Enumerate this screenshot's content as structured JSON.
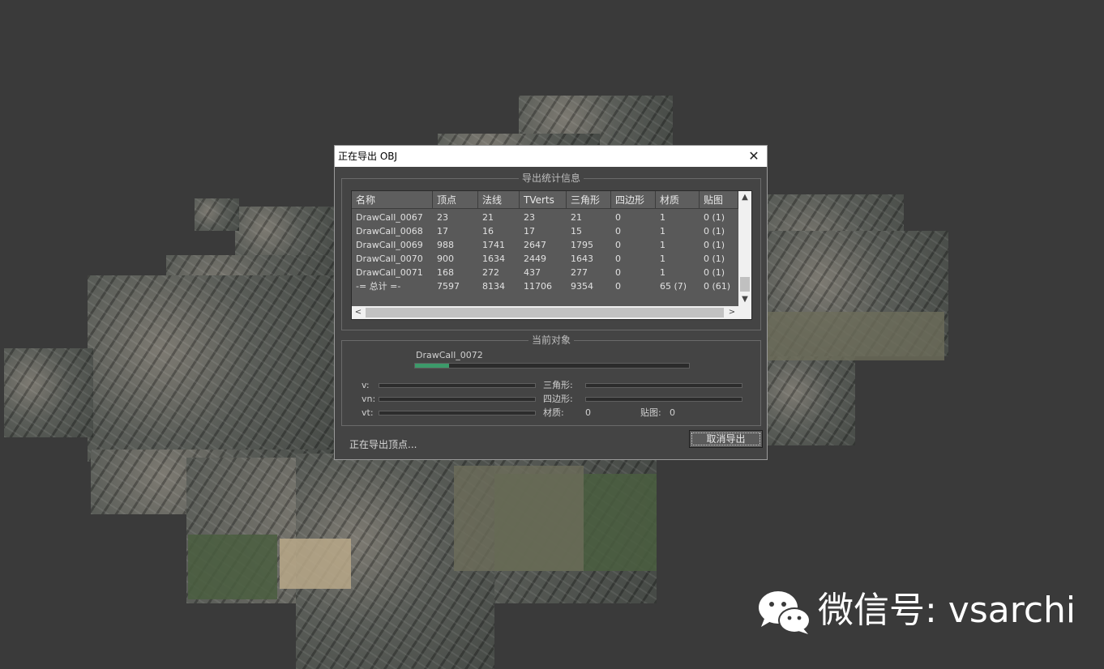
{
  "window": {
    "title": "正在导出 OBJ",
    "close_glyph": "✕"
  },
  "stats": {
    "group_title": "导出统计信息",
    "columns": [
      "名称",
      "顶点",
      "法线",
      "TVerts",
      "三角形",
      "四边形",
      "材质",
      "贴图"
    ],
    "rows": [
      [
        "DrawCall_0067",
        "23",
        "21",
        "23",
        "21",
        "0",
        "1",
        "0 (1)"
      ],
      [
        "DrawCall_0068",
        "17",
        "16",
        "17",
        "15",
        "0",
        "1",
        "0 (1)"
      ],
      [
        "DrawCall_0069",
        "988",
        "1741",
        "2647",
        "1795",
        "0",
        "1",
        "0 (1)"
      ],
      [
        "DrawCall_0070",
        "900",
        "1634",
        "2449",
        "1643",
        "0",
        "1",
        "0 (1)"
      ],
      [
        "DrawCall_0071",
        "168",
        "272",
        "437",
        "277",
        "0",
        "1",
        "0 (1)"
      ],
      [
        "-= 总计 =-",
        "7597",
        "8134",
        "11706",
        "9354",
        "0",
        "65 (7)",
        "0 (61)"
      ]
    ],
    "scroll_up": "▲",
    "scroll_down": "▼",
    "scroll_left": "<",
    "scroll_right": ">"
  },
  "current": {
    "group_title": "当前对象",
    "object_name": "DrawCall_0072",
    "progress": 0.125,
    "v_label": "v:",
    "vn_label": "vn:",
    "vt_label": "vt:",
    "tri_label": "三角形:",
    "quad_label": "四边形:",
    "material_label": "材质:",
    "material_value": "0",
    "map_label": "贴图:",
    "map_value": "0"
  },
  "status": "正在导出顶点...",
  "cancel_label": "取消导出",
  "watermark": {
    "text": "微信号: vsarchi"
  }
}
